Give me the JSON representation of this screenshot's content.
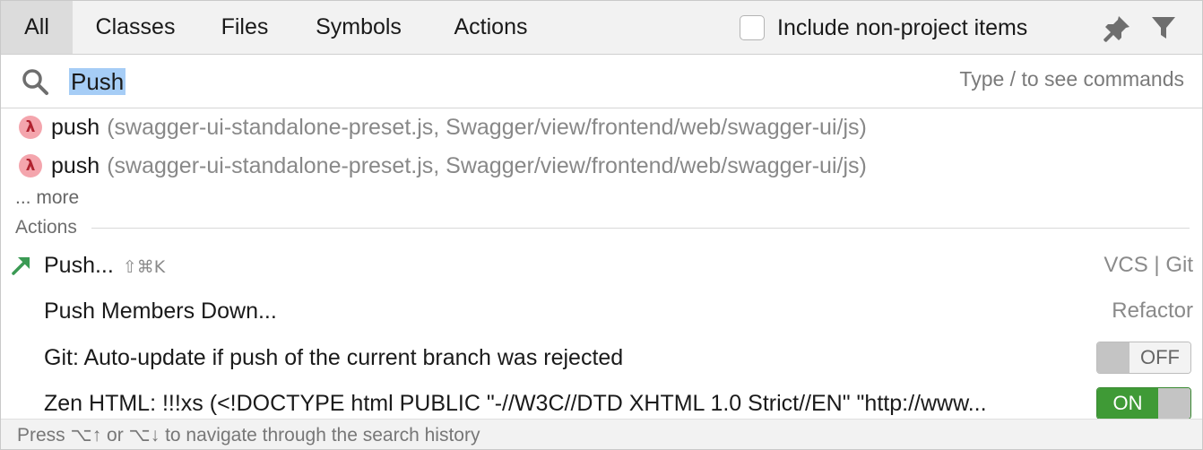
{
  "tabs": [
    {
      "label": "All",
      "selected": true
    },
    {
      "label": "Classes",
      "selected": false
    },
    {
      "label": "Files",
      "selected": false
    },
    {
      "label": "Symbols",
      "selected": false
    },
    {
      "label": "Actions",
      "selected": false
    }
  ],
  "toolbar": {
    "include_non_project_label": "Include non-project items",
    "include_non_project_checked": false,
    "pin_icon": "pin-icon",
    "filter_icon": "filter-icon"
  },
  "search": {
    "value": "Push",
    "hint": "Type / to see commands",
    "icon": "search-icon",
    "selection_color": "#a6cdf6"
  },
  "results": [
    {
      "icon": "lambda-icon",
      "icon_glyph": "λ",
      "name": "push",
      "path": "(swagger-ui-standalone-preset.js, Swagger/view/frontend/web/swagger-ui/js)"
    },
    {
      "icon": "lambda-icon",
      "icon_glyph": "λ",
      "name": "push",
      "path": "(swagger-ui-standalone-preset.js, Swagger/view/frontend/web/swagger-ui/js)"
    }
  ],
  "more_label": "... more",
  "actions_section": {
    "label": "Actions",
    "items": [
      {
        "label": "Push...",
        "shortcut": "⇧⌘K",
        "category": "VCS | Git",
        "icon": "push-arrow-icon"
      },
      {
        "label": "Push Members Down...",
        "category": "Refactor"
      },
      {
        "label": "Git: Auto-update if push of the current branch was rejected",
        "toggle": "OFF"
      },
      {
        "label": "Zen HTML: !!!xs (<!DOCTYPE html PUBLIC \"-//W3C//DTD XHTML 1.0 Strict//EN\" \"http://www...",
        "toggle": "ON"
      }
    ]
  },
  "footer": {
    "text": "Press ⌥↑ or ⌥↓ to navigate through the search history"
  },
  "colors": {
    "toggle_on": "#3f9a36",
    "lambda_bg": "#f4a5ad",
    "push_arrow": "#3b9a54"
  }
}
